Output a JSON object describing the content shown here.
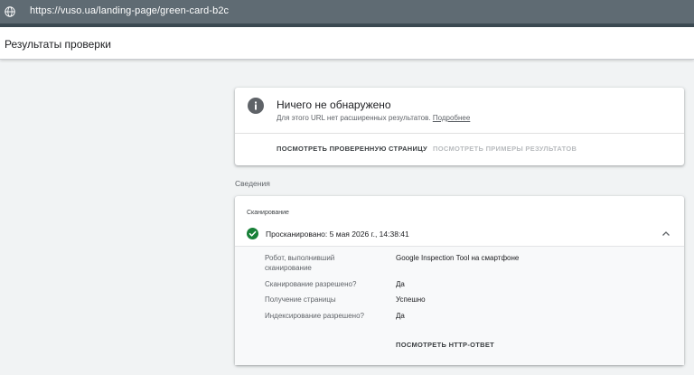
{
  "address_bar": {
    "url": "https://vuso.ua/landing-page/green-card-b2c"
  },
  "header": {
    "title": "Результаты проверки"
  },
  "result_card": {
    "heading": "Ничего не обнаружено",
    "description": "Для этого URL нет расширенных результатов.",
    "more_link": "Подробнее",
    "view_page_button": "ПОСМОТРЕТЬ ПРОВЕРЕННУЮ СТРАНИЦУ",
    "view_examples_button": "ПОСМОТРЕТЬ ПРИМЕРЫ РЕЗУЛЬТАТОВ"
  },
  "details": {
    "section_label": "Сведения",
    "crawl": {
      "subtitle": "Сканирование",
      "status": "Просканировано: 5 мая 2026 г., 14:38:41",
      "rows": [
        {
          "label": "Робот, выполнивший сканирование",
          "value": "Google Inspection Tool на смартфоне"
        },
        {
          "label": "Сканирование разрешено?",
          "value": "Да"
        },
        {
          "label": "Получение страницы",
          "value": "Успешно"
        },
        {
          "label": "Индексирование разрешено?",
          "value": "Да"
        }
      ],
      "http_button": "ПОСМОТРЕТЬ HTTP-ОТВЕТ"
    }
  },
  "colors": {
    "success": "#188038",
    "topbar": "#5f6b73",
    "icon_grey": "#5f6368"
  },
  "icons": {
    "globe": "globe-icon",
    "info": "info-icon",
    "check": "check-circle-icon",
    "chevron": "chevron-up-icon"
  }
}
